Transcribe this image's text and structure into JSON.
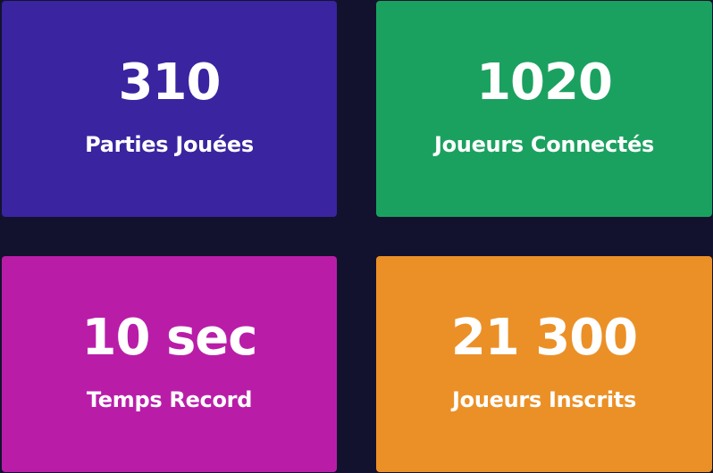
{
  "colors": {
    "page_background": "#12122e",
    "card_parties": "#3a24a0",
    "card_joueurs_connectes": "#1ba15f",
    "card_temps_record": "#b91da8",
    "card_joueurs_inscrits": "#eb9027",
    "text": "#ffffff"
  },
  "stats": [
    {
      "value": "310",
      "label": "Parties Jouées"
    },
    {
      "value": "1020",
      "label": "Joueurs Connectés"
    },
    {
      "value": "10 sec",
      "label": "Temps Record"
    },
    {
      "value": "21 300",
      "label": "Joueurs Inscrits"
    }
  ]
}
